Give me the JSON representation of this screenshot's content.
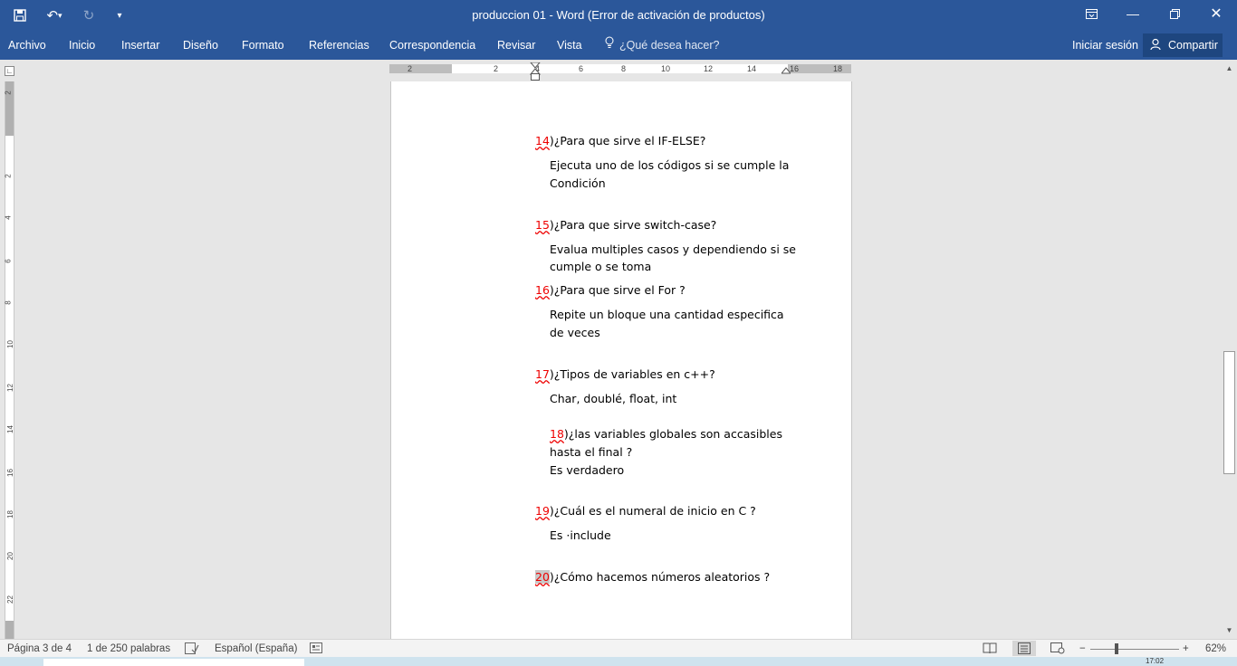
{
  "titlebar": {
    "title": "produccion 01 - Word (Error de activación de productos)",
    "save_icon": "save-icon",
    "undo_icon": "undo-icon",
    "redo_icon": "redo-icon",
    "customize_icon": "customize-qat-icon",
    "ribbon_display_icon": "ribbon-display-options-icon",
    "minimize_icon": "minimize-icon",
    "restore_icon": "restore-icon",
    "close_icon": "close-icon"
  },
  "ribbon": {
    "tabs": [
      "Archivo",
      "Inicio",
      "Insertar",
      "Diseño",
      "Formato",
      "Referencias",
      "Correspondencia",
      "Revisar",
      "Vista"
    ],
    "tell_me": "¿Qué desea hacer?",
    "sign_in": "Iniciar sesión",
    "share": "Compartir"
  },
  "ruler": {
    "horizontal_ticks": [
      "2",
      "2",
      "4",
      "6",
      "8",
      "10",
      "12",
      "14",
      "16",
      "18"
    ],
    "vertical_ticks": [
      "2",
      "2",
      "4",
      "6",
      "8",
      "10",
      "12",
      "14",
      "16",
      "18",
      "20",
      "22"
    ]
  },
  "document": {
    "q14": {
      "num": "14",
      "text": ")¿Para que sirve el IF-ELSE?"
    },
    "a14": {
      "line1": "Ejecuta uno de los códigos si se cumple la",
      "line2": "Condición"
    },
    "q15": {
      "num": "15",
      "text": ")¿Para que sirve switch-case?"
    },
    "a15": {
      "line1": "Evalua multiples casos y dependiendo si se",
      "line2": "cumple o se toma"
    },
    "q16": {
      "num": "16",
      "text": ")¿Para que sirve el For ?"
    },
    "a16": {
      "line1": "Repite un bloque una cantidad especifica",
      "line2": "de veces"
    },
    "q17": {
      "num": "17",
      "text": ")¿Tipos de variables en c++?"
    },
    "a17": {
      "line1": "Char, doublé, float, int"
    },
    "q18": {
      "num": "18",
      "text": ")¿las variables globales son accasibles",
      "line2": "hasta el final ?"
    },
    "a18": {
      "line1": "Es verdadero"
    },
    "q19": {
      "num": "19",
      "text": ")¿Cuál es el numeral de inicio en C ?"
    },
    "a19": {
      "line1": "Es ·include"
    },
    "q20": {
      "num": "20",
      "text": ")¿Cómo hacemos números aleatorios ?"
    }
  },
  "statusbar": {
    "page": "Página 3 de 4",
    "words": "1 de 250 palabras",
    "language": "Español (España)",
    "zoom": "62%",
    "zoom_out": "−",
    "zoom_in": "+"
  },
  "taskbar": {
    "time": "17:02"
  }
}
